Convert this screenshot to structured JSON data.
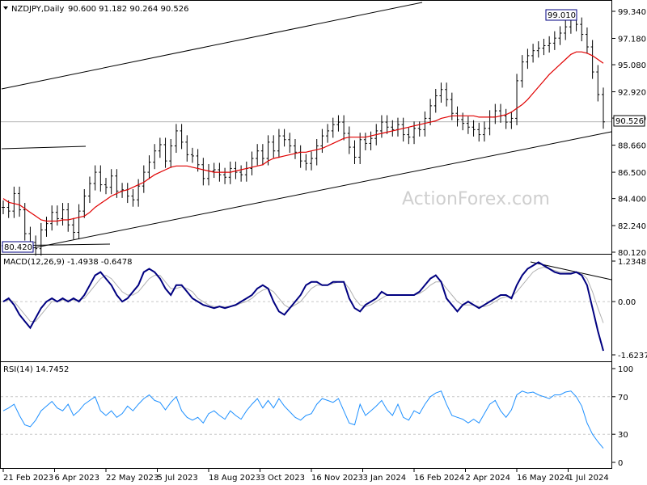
{
  "header": {
    "symbol": "NZDJPY,Daily",
    "ohlc": "90.600 91.182 90.264 90.526",
    "watermark": "ActionForex.com"
  },
  "colors": {
    "price": "#000000",
    "ma": "#e00000",
    "macd": "#000080",
    "signal": "#b0b0b0",
    "rsi": "#1e90ff",
    "channel": "#000000",
    "grid": "#c8c8c8"
  },
  "price_panel": {
    "current_label": "90.526",
    "high_label": "99.010",
    "low_label": "80.420",
    "y_ticks": [
      "99.340",
      "97.180",
      "95.080",
      "92.920",
      "90.820",
      "88.660",
      "86.500",
      "84.400",
      "82.240",
      "80.120"
    ]
  },
  "macd_panel": {
    "label": "MACD(12,26,9) -1.4938 -0.6478",
    "y_ticks": [
      "1.2348",
      "0.00",
      "-1.6237"
    ]
  },
  "rsi_panel": {
    "label": "RSI(14) 14.7452",
    "y_ticks": [
      "100",
      "70",
      "30",
      "0"
    ]
  },
  "x_labels": [
    "21 Feb 2023",
    "6 Apr 2023",
    "22 May 2023",
    "5 Jul 2023",
    "18 Aug 2023",
    "3 Oct 2023",
    "16 Nov 2023",
    "3 Jan 2024",
    "16 Feb 2024",
    "2 Apr 2024",
    "16 May 2024",
    "1 Jul 2024"
  ],
  "chart_data": [
    {
      "type": "line",
      "title": "NZDJPY,Daily",
      "series": [
        {
          "name": "NZDJPY",
          "values": [
            83.7,
            83.4,
            84.8,
            83.5,
            81.6,
            80.9,
            80.4,
            81.9,
            82.4,
            83.3,
            82.8,
            83.5,
            82.3,
            81.7,
            83.4,
            84.6,
            85.6,
            86.5,
            85.5,
            85.3,
            86.2,
            85.0,
            85.1,
            84.6,
            84.3,
            85.4,
            86.5,
            87.3,
            88.2,
            88.7,
            87.4,
            88.6,
            89.8,
            88.9,
            87.9,
            87.8,
            87.1,
            86.0,
            86.6,
            86.7,
            86.3,
            86.1,
            86.8,
            86.5,
            86.3,
            86.8,
            87.6,
            88.2,
            87.6,
            88.9,
            88.2,
            89.4,
            89.1,
            88.6,
            88.1,
            87.4,
            87.2,
            87.6,
            88.6,
            89.4,
            89.8,
            90.3,
            90.5,
            89.6,
            88.5,
            87.7,
            89.1,
            88.8,
            89.2,
            89.8,
            90.5,
            90.1,
            89.9,
            90.3,
            89.5,
            89.3,
            90.0,
            89.9,
            90.8,
            91.8,
            92.6,
            93.1,
            92.3,
            91.2,
            90.7,
            90.4,
            90.1,
            89.9,
            89.5,
            90.0,
            90.9,
            91.4,
            91.0,
            90.5,
            90.8,
            93.8,
            95.3,
            95.8,
            96.2,
            96.4,
            96.6,
            96.8,
            97.2,
            97.6,
            98.1,
            98.8,
            98.3,
            97.5,
            96.5,
            94.5,
            92.7,
            90.52
          ]
        },
        {
          "name": "MA",
          "values": [
            84.4,
            84.1,
            84.0,
            83.9,
            83.6,
            83.3,
            83.0,
            82.7,
            82.6,
            82.6,
            82.6,
            82.7,
            82.7,
            82.8,
            82.9,
            83.0,
            83.3,
            83.7,
            84.0,
            84.3,
            84.6,
            84.8,
            85.0,
            85.1,
            85.3,
            85.5,
            85.7,
            86.0,
            86.3,
            86.5,
            86.7,
            86.9,
            87.0,
            87.0,
            87.0,
            86.9,
            86.8,
            86.7,
            86.6,
            86.5,
            86.5,
            86.5,
            86.5,
            86.6,
            86.7,
            86.8,
            86.9,
            87.0,
            87.1,
            87.4,
            87.6,
            87.7,
            87.8,
            87.9,
            88.0,
            88.1,
            88.1,
            88.2,
            88.3,
            88.4,
            88.6,
            88.8,
            89.0,
            89.2,
            89.3,
            89.3,
            89.3,
            89.3,
            89.4,
            89.5,
            89.6,
            89.7,
            89.8,
            89.9,
            90.0,
            90.1,
            90.2,
            90.3,
            90.4,
            90.5,
            90.6,
            90.8,
            90.9,
            91.0,
            91.0,
            91.0,
            91.0,
            91.0,
            90.9,
            90.9,
            90.9,
            90.9,
            91.0,
            91.1,
            91.3,
            91.6,
            91.9,
            92.3,
            92.8,
            93.3,
            93.8,
            94.3,
            94.7,
            95.1,
            95.5,
            95.9,
            96.1,
            96.1,
            96.0,
            95.8,
            95.5,
            95.2
          ]
        }
      ],
      "ylim": [
        80.12,
        99.34
      ],
      "annotations": [
        "99.010",
        "80.420",
        "90.526"
      ]
    },
    {
      "type": "line",
      "title": "MACD(12,26,9) -1.4938 -0.6478",
      "series": [
        {
          "name": "MACD",
          "values": [
            0.0,
            0.1,
            -0.1,
            -0.4,
            -0.6,
            -0.8,
            -0.5,
            -0.2,
            0.0,
            0.1,
            0.0,
            0.1,
            0.0,
            0.1,
            0.0,
            0.2,
            0.5,
            0.8,
            0.9,
            0.7,
            0.5,
            0.2,
            0.0,
            0.1,
            0.3,
            0.5,
            0.9,
            1.0,
            0.9,
            0.7,
            0.4,
            0.2,
            0.5,
            0.5,
            0.3,
            0.1,
            0.0,
            -0.1,
            -0.15,
            -0.2,
            -0.15,
            -0.2,
            -0.15,
            -0.1,
            0.0,
            0.1,
            0.2,
            0.4,
            0.5,
            0.4,
            0.0,
            -0.3,
            -0.4,
            -0.2,
            0.0,
            0.2,
            0.5,
            0.6,
            0.6,
            0.5,
            0.5,
            0.6,
            0.6,
            0.6,
            0.1,
            -0.2,
            -0.3,
            -0.1,
            0.0,
            0.1,
            0.3,
            0.2,
            0.2,
            0.2,
            0.2,
            0.2,
            0.2,
            0.3,
            0.5,
            0.7,
            0.8,
            0.6,
            0.1,
            -0.1,
            -0.3,
            -0.1,
            0.0,
            -0.1,
            -0.2,
            -0.1,
            0.0,
            0.1,
            0.2,
            0.2,
            0.1,
            0.5,
            0.8,
            1.0,
            1.1,
            1.2,
            1.1,
            1.0,
            0.9,
            0.85,
            0.85,
            0.85,
            0.9,
            0.8,
            0.5,
            -0.2,
            -0.9,
            -1.5
          ]
        },
        {
          "name": "Signal",
          "values": [
            0.0,
            0.05,
            0.0,
            -0.2,
            -0.4,
            -0.6,
            -0.6,
            -0.4,
            -0.2,
            0.0,
            0.0,
            0.05,
            0.05,
            0.05,
            0.05,
            0.1,
            0.3,
            0.5,
            0.7,
            0.8,
            0.7,
            0.5,
            0.3,
            0.2,
            0.2,
            0.3,
            0.5,
            0.7,
            0.8,
            0.8,
            0.6,
            0.4,
            0.4,
            0.45,
            0.4,
            0.3,
            0.1,
            0.0,
            -0.1,
            -0.15,
            -0.15,
            -0.15,
            -0.15,
            -0.12,
            -0.05,
            0.0,
            0.1,
            0.25,
            0.35,
            0.4,
            0.3,
            0.1,
            -0.1,
            -0.2,
            -0.1,
            0.0,
            0.2,
            0.4,
            0.5,
            0.5,
            0.5,
            0.55,
            0.6,
            0.6,
            0.4,
            0.1,
            -0.1,
            -0.15,
            -0.1,
            0.0,
            0.1,
            0.2,
            0.2,
            0.2,
            0.2,
            0.2,
            0.2,
            0.25,
            0.35,
            0.5,
            0.6,
            0.6,
            0.4,
            0.2,
            0.0,
            -0.1,
            -0.1,
            -0.1,
            -0.15,
            -0.15,
            -0.1,
            0.0,
            0.1,
            0.15,
            0.15,
            0.3,
            0.5,
            0.7,
            0.9,
            1.0,
            1.05,
            1.0,
            0.95,
            0.9,
            0.9,
            0.88,
            0.88,
            0.85,
            0.7,
            0.3,
            -0.2,
            -0.65
          ]
        }
      ],
      "ylim": [
        -1.6237,
        1.2348
      ]
    },
    {
      "type": "line",
      "title": "RSI(14) 14.7452",
      "series": [
        {
          "name": "RSI",
          "values": [
            55,
            58,
            62,
            50,
            40,
            38,
            45,
            55,
            60,
            65,
            58,
            55,
            62,
            50,
            55,
            62,
            66,
            70,
            55,
            50,
            55,
            48,
            52,
            60,
            55,
            62,
            68,
            72,
            66,
            64,
            56,
            64,
            70,
            55,
            48,
            45,
            48,
            42,
            52,
            55,
            50,
            46,
            55,
            50,
            46,
            55,
            62,
            68,
            58,
            66,
            58,
            68,
            60,
            54,
            48,
            45,
            50,
            52,
            62,
            68,
            66,
            64,
            68,
            55,
            42,
            40,
            62,
            50,
            55,
            60,
            66,
            56,
            50,
            62,
            48,
            45,
            55,
            52,
            62,
            70,
            74,
            76,
            62,
            50,
            48,
            46,
            42,
            46,
            42,
            52,
            62,
            66,
            55,
            48,
            56,
            72,
            76,
            74,
            75,
            72,
            70,
            68,
            72,
            72,
            75,
            76,
            70,
            60,
            42,
            30,
            22,
            15
          ]
        }
      ],
      "ylim": [
        0,
        100
      ]
    }
  ]
}
